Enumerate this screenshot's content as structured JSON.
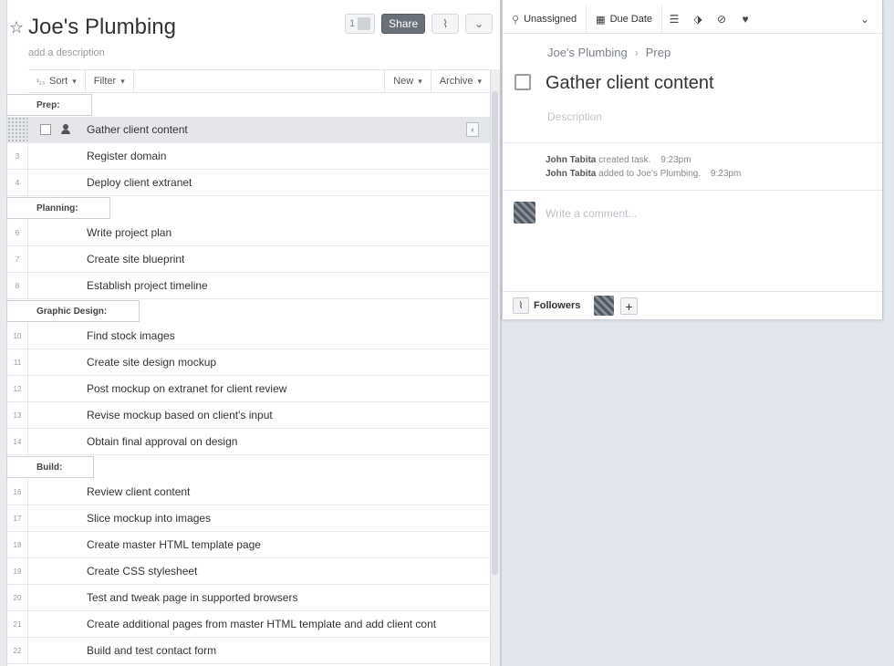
{
  "project": {
    "title": "Joe's Plumbing",
    "description_placeholder": "add a description",
    "member_count": "1",
    "share_label": "Share"
  },
  "toolbar": {
    "sort_label": "Sort",
    "filter_label": "Filter",
    "new_label": "New",
    "archive_label": "Archive"
  },
  "sections": [
    {
      "label": "Prep:",
      "tasks": [
        {
          "num": "",
          "name": "Gather client content",
          "selected": true
        },
        {
          "num": "3",
          "name": "Register domain"
        },
        {
          "num": "4",
          "name": "Deploy client extranet"
        }
      ]
    },
    {
      "label": "Planning:",
      "tasks": [
        {
          "num": "6",
          "name": "Write project plan"
        },
        {
          "num": "7",
          "name": "Create site blueprint"
        },
        {
          "num": "8",
          "name": "Establish project timeline"
        }
      ]
    },
    {
      "label": "Graphic Design:",
      "tasks": [
        {
          "num": "10",
          "name": "Find stock images"
        },
        {
          "num": "11",
          "name": "Create site design mockup"
        },
        {
          "num": "12",
          "name": "Post mockup on extranet for client review"
        },
        {
          "num": "13",
          "name": "Revise mockup based on client's input"
        },
        {
          "num": "14",
          "name": "Obtain final approval on design"
        }
      ]
    },
    {
      "label": "Build:",
      "tasks": [
        {
          "num": "16",
          "name": "Review client content"
        },
        {
          "num": "17",
          "name": "Slice mockup into images"
        },
        {
          "num": "18",
          "name": "Create master HTML template page"
        },
        {
          "num": "19",
          "name": "Create CSS stylesheet"
        },
        {
          "num": "20",
          "name": "Test and tweak page in supported browsers"
        },
        {
          "num": "21",
          "name": "Create additional pages from master HTML template and add client cont"
        },
        {
          "num": "22",
          "name": "Build and test contact form"
        }
      ]
    }
  ],
  "detail": {
    "assignee_label": "Unassigned",
    "due_date_label": "Due Date",
    "breadcrumb": [
      "Joe's Plumbing",
      "Prep"
    ],
    "title": "Gather client content",
    "description_placeholder": "Description",
    "activity": [
      {
        "user": "John Tabita",
        "action": "created task.",
        "time": "9:23pm"
      },
      {
        "user": "John Tabita",
        "action": "added to Joe's Plumbing.",
        "time": "9:23pm"
      }
    ],
    "comment_placeholder": "Write a comment...",
    "followers_label": "Followers"
  }
}
